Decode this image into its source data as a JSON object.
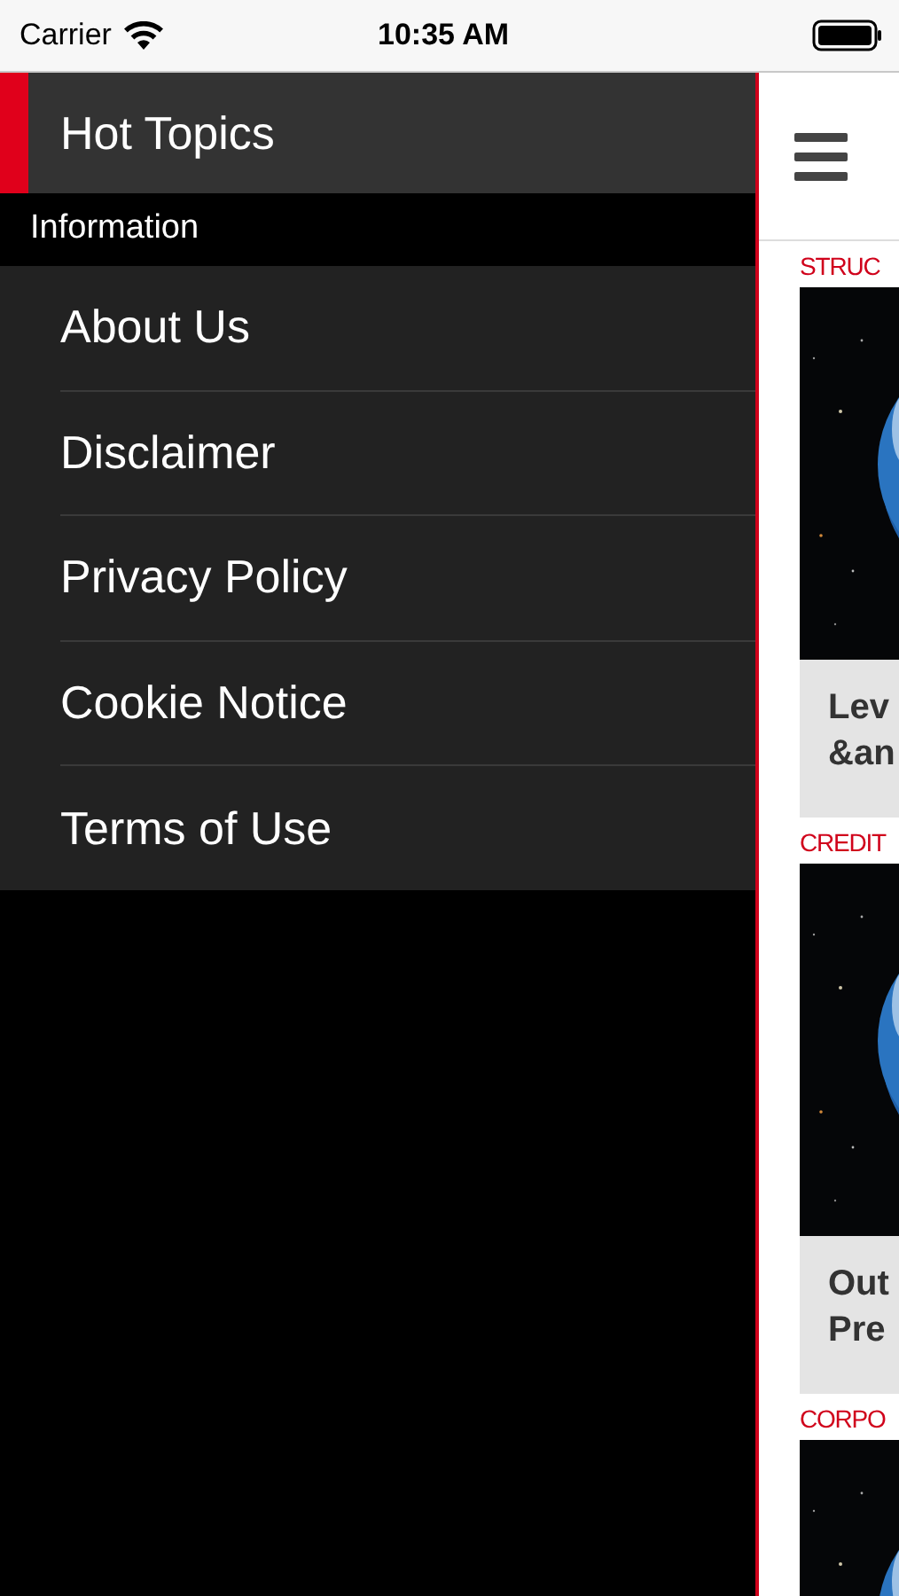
{
  "status_bar": {
    "carrier": "Carrier",
    "time": "10:35 AM"
  },
  "drawer": {
    "top_items": [
      {
        "label": "Hot Topics",
        "selected": true
      }
    ],
    "sections": [
      {
        "title": "Information",
        "items": [
          {
            "label": "About Us",
            "selected": false
          },
          {
            "label": "Disclaimer",
            "selected": false
          },
          {
            "label": "Privacy Policy",
            "selected": false
          },
          {
            "label": "Cookie Notice",
            "selected": false
          },
          {
            "label": "Terms of Use",
            "selected": false
          }
        ]
      }
    ]
  },
  "content": {
    "articles": [
      {
        "category": "STRUC",
        "picture": {
          "kind": "picture"
        },
        "title_lines": [
          "Lev",
          "&an"
        ]
      },
      {
        "category": "CREDIT",
        "picture": {
          "kind": "picture"
        },
        "title_lines": [
          "Out",
          "Pre"
        ]
      },
      {
        "category": "CORPO",
        "picture": {
          "kind": "picture"
        }
      }
    ]
  }
}
